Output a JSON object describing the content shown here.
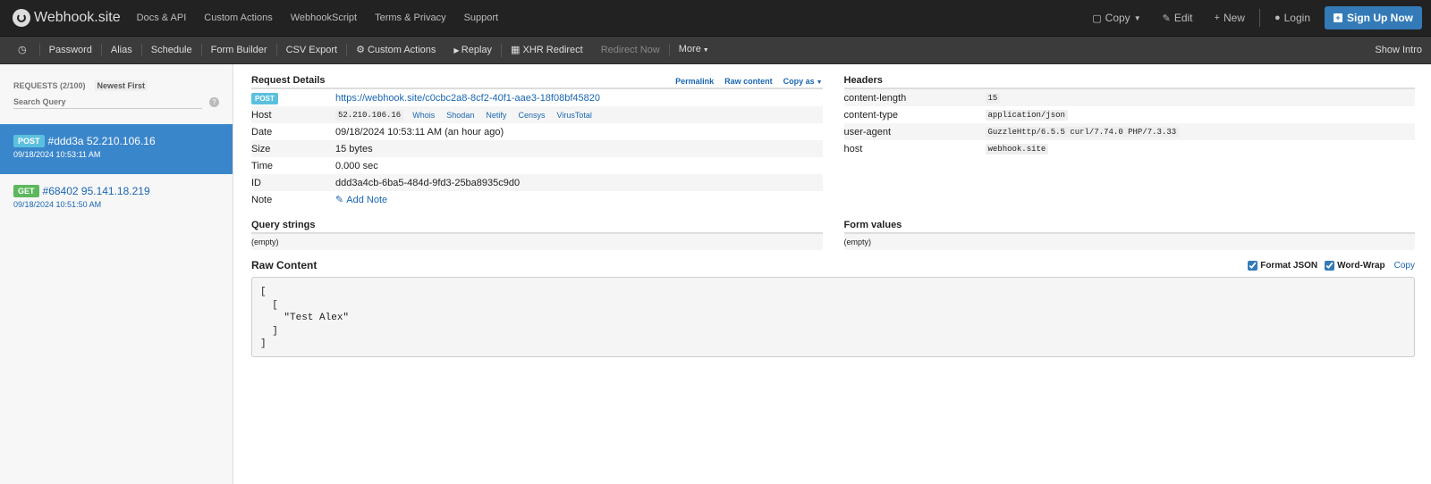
{
  "brand": {
    "name": "Webhook.site"
  },
  "nav": [
    "Docs & API",
    "Custom Actions",
    "WebhookScript",
    "Terms & Privacy",
    "Support"
  ],
  "right_nav": {
    "copy": "Copy",
    "edit": "Edit",
    "new": "New",
    "login": "Login",
    "signup": "Sign Up Now"
  },
  "toolbar": {
    "items": [
      "Password",
      "Alias",
      "Schedule",
      "Form Builder",
      "CSV Export",
      "Custom Actions",
      "Replay",
      "XHR Redirect"
    ],
    "redirect_now": "Redirect Now",
    "more": "More",
    "show_intro": "Show Intro"
  },
  "sidebar": {
    "requests_label": "REQUESTS (2/100)",
    "sort_label": "Newest First",
    "search_placeholder": "Search Query",
    "requests": [
      {
        "method": "POST",
        "title": "#ddd3a 52.210.106.16",
        "time": "09/18/2024 10:53:11 AM"
      },
      {
        "method": "GET",
        "title": "#68402 95.141.18.219",
        "time": "09/18/2024 10:51:50 AM"
      }
    ]
  },
  "details": {
    "title": "Request Details",
    "links": {
      "permalink": "Permalink",
      "raw": "Raw content",
      "copy_as": "Copy as"
    },
    "method": "POST",
    "url": "https://webhook.site/c0cbc2a8-8cf2-40f1-aae3-18f08bf45820",
    "host_label": "Host",
    "host": "52.210.106.16",
    "host_links": [
      "Whois",
      "Shodan",
      "Netify",
      "Censys",
      "VirusTotal"
    ],
    "date_label": "Date",
    "date": "09/18/2024 10:53:11 AM (an hour ago)",
    "size_label": "Size",
    "size": "15 bytes",
    "time_label": "Time",
    "time": "0.000 sec",
    "id_label": "ID",
    "id": "ddd3a4cb-6ba5-484d-9fd3-25ba8935c9d0",
    "note_label": "Note",
    "add_note": "Add Note"
  },
  "headers": {
    "title": "Headers",
    "rows": [
      {
        "k": "content-length",
        "v": "15"
      },
      {
        "k": "content-type",
        "v": "application/json"
      },
      {
        "k": "user-agent",
        "v": "GuzzleHttp/6.5.5 curl/7.74.0 PHP/7.3.33"
      },
      {
        "k": "host",
        "v": "webhook.site"
      }
    ]
  },
  "query": {
    "title": "Query strings",
    "value": "(empty)"
  },
  "form": {
    "title": "Form values",
    "value": "(empty)"
  },
  "raw": {
    "title": "Raw Content",
    "format_json": "Format JSON",
    "word_wrap": "Word-Wrap",
    "copy": "Copy",
    "body": "[\n  [\n    \"Test Alex\"\n  ]\n]"
  }
}
